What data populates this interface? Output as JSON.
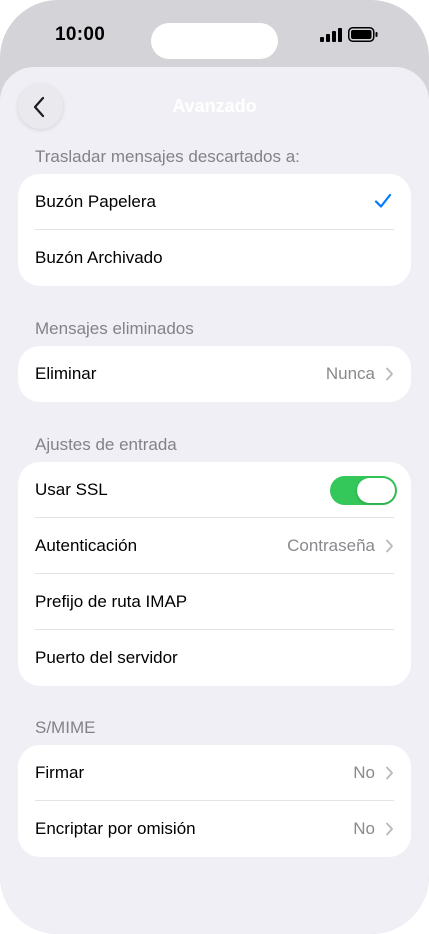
{
  "status_bar": {
    "time": "10:00"
  },
  "nav": {
    "title": "Avanzado"
  },
  "sections": {
    "move_discarded": {
      "header": "Trasladar mensajes descartados a:",
      "trash_label": "Buzón Papelera",
      "archive_label": "Buzón Archivado",
      "selected": "Buzón Papelera"
    },
    "deleted": {
      "header": "Mensajes eliminados",
      "delete_label": "Eliminar",
      "delete_value": "Nunca"
    },
    "incoming": {
      "header": "Ajustes de entrada",
      "ssl_label": "Usar SSL",
      "ssl_on": true,
      "auth_label": "Autenticación",
      "auth_value": "Contraseña",
      "imap_prefix_label": "Prefijo de ruta IMAP",
      "server_port_label": "Puerto del servidor"
    },
    "smime": {
      "header": "S/MIME",
      "sign_label": "Firmar",
      "sign_value": "No",
      "encrypt_label": "Encriptar por omisión",
      "encrypt_value": "No"
    }
  },
  "colors": {
    "accent": "#007aff",
    "toggle_on": "#34c759",
    "background": "#f0eff5"
  }
}
